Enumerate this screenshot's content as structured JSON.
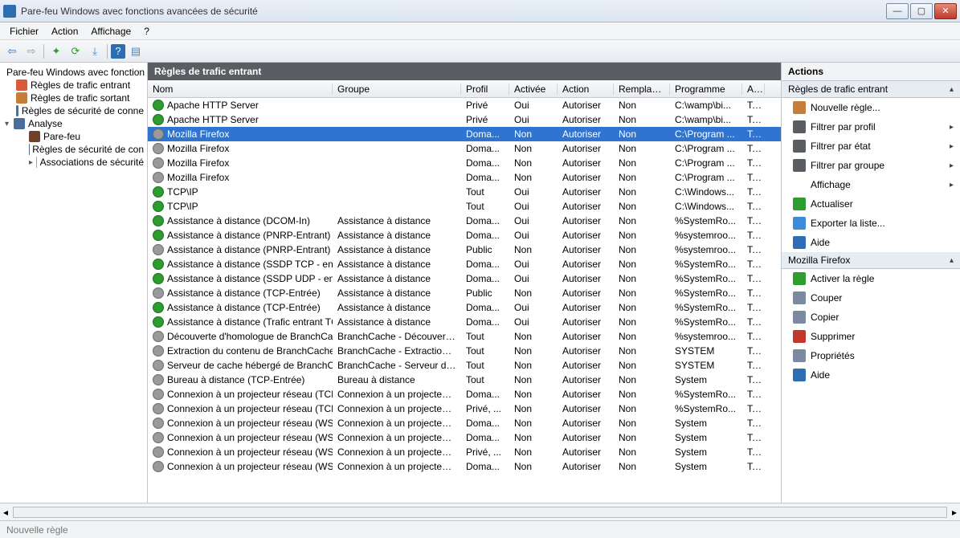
{
  "titlebar": {
    "title": "Pare-feu Windows avec fonctions avancées de sécurité"
  },
  "menubar": [
    "Fichier",
    "Action",
    "Affichage",
    "?"
  ],
  "tree": {
    "root": "Pare-feu Windows avec fonction",
    "items": [
      "Règles de trafic entrant",
      "Règles de trafic sortant",
      "Règles de sécurité de conne"
    ],
    "analyse": "Analyse",
    "analyse_children": [
      "Pare-feu",
      "Règles de sécurité de con",
      "Associations de sécurité"
    ]
  },
  "grid": {
    "title": "Règles de trafic entrant",
    "headers": {
      "nom": "Nom",
      "grp": "Groupe",
      "prof": "Profil",
      "act": "Activée",
      "action": "Action",
      "rep": "Remplacer",
      "prog": "Programme",
      "adr": "Adr"
    },
    "rows": [
      {
        "on": true,
        "nom": "Apache HTTP Server",
        "grp": "",
        "prof": "Privé",
        "act": "Oui",
        "action": "Autoriser",
        "rep": "Non",
        "prog": "C:\\wamp\\bi...",
        "adr": "Tou"
      },
      {
        "on": true,
        "nom": "Apache HTTP Server",
        "grp": "",
        "prof": "Privé",
        "act": "Oui",
        "action": "Autoriser",
        "rep": "Non",
        "prog": "C:\\wamp\\bi...",
        "adr": "Tou"
      },
      {
        "on": false,
        "sel": true,
        "nom": "Mozilla Firefox",
        "grp": "",
        "prof": "Doma...",
        "act": "Non",
        "action": "Autoriser",
        "rep": "Non",
        "prog": "C:\\Program ...",
        "adr": "Tou"
      },
      {
        "on": false,
        "nom": "Mozilla Firefox",
        "grp": "",
        "prof": "Doma...",
        "act": "Non",
        "action": "Autoriser",
        "rep": "Non",
        "prog": "C:\\Program ...",
        "adr": "Tou"
      },
      {
        "on": false,
        "nom": "Mozilla Firefox",
        "grp": "",
        "prof": "Doma...",
        "act": "Non",
        "action": "Autoriser",
        "rep": "Non",
        "prog": "C:\\Program ...",
        "adr": "Tou"
      },
      {
        "on": false,
        "nom": "Mozilla Firefox",
        "grp": "",
        "prof": "Doma...",
        "act": "Non",
        "action": "Autoriser",
        "rep": "Non",
        "prog": "C:\\Program ...",
        "adr": "Tou"
      },
      {
        "on": true,
        "nom": "TCP\\IP",
        "grp": "",
        "prof": "Tout",
        "act": "Oui",
        "action": "Autoriser",
        "rep": "Non",
        "prog": "C:\\Windows...",
        "adr": "Tou"
      },
      {
        "on": true,
        "nom": "TCP\\IP",
        "grp": "",
        "prof": "Tout",
        "act": "Oui",
        "action": "Autoriser",
        "rep": "Non",
        "prog": "C:\\Windows...",
        "adr": "Tou"
      },
      {
        "on": true,
        "nom": "Assistance à distance (DCOM-In)",
        "grp": "Assistance à distance",
        "prof": "Doma...",
        "act": "Oui",
        "action": "Autoriser",
        "rep": "Non",
        "prog": "%SystemRo...",
        "adr": "Tou"
      },
      {
        "on": true,
        "nom": "Assistance à distance (PNRP-Entrant)",
        "grp": "Assistance à distance",
        "prof": "Doma...",
        "act": "Oui",
        "action": "Autoriser",
        "rep": "Non",
        "prog": "%systemroo...",
        "adr": "Tou"
      },
      {
        "on": false,
        "nom": "Assistance à distance (PNRP-Entrant)",
        "grp": "Assistance à distance",
        "prof": "Public",
        "act": "Non",
        "action": "Autoriser",
        "rep": "Non",
        "prog": "%systemroo...",
        "adr": "Tou"
      },
      {
        "on": true,
        "nom": "Assistance à distance (SSDP TCP - en ent...",
        "grp": "Assistance à distance",
        "prof": "Doma...",
        "act": "Oui",
        "action": "Autoriser",
        "rep": "Non",
        "prog": "%SystemRo...",
        "adr": "Tou"
      },
      {
        "on": true,
        "nom": "Assistance à distance (SSDP UDP - en ent...",
        "grp": "Assistance à distance",
        "prof": "Doma...",
        "act": "Oui",
        "action": "Autoriser",
        "rep": "Non",
        "prog": "%SystemRo...",
        "adr": "Tou"
      },
      {
        "on": false,
        "nom": "Assistance à distance (TCP-Entrée)",
        "grp": "Assistance à distance",
        "prof": "Public",
        "act": "Non",
        "action": "Autoriser",
        "rep": "Non",
        "prog": "%SystemRo...",
        "adr": "Tou"
      },
      {
        "on": true,
        "nom": "Assistance à distance (TCP-Entrée)",
        "grp": "Assistance à distance",
        "prof": "Doma...",
        "act": "Oui",
        "action": "Autoriser",
        "rep": "Non",
        "prog": "%SystemRo...",
        "adr": "Tou"
      },
      {
        "on": true,
        "nom": "Assistance à distance (Trafic entrant TCP ...",
        "grp": "Assistance à distance",
        "prof": "Doma...",
        "act": "Oui",
        "action": "Autoriser",
        "rep": "Non",
        "prog": "%SystemRo...",
        "adr": "Tou"
      },
      {
        "on": false,
        "nom": "Découverte d'homologue de BranchCac...",
        "grp": "BranchCache - Découverte ...",
        "prof": "Tout",
        "act": "Non",
        "action": "Autoriser",
        "rep": "Non",
        "prog": "%systemroo...",
        "adr": "Tou"
      },
      {
        "on": false,
        "nom": "Extraction du contenu de BranchCache (...",
        "grp": "BranchCache - Extraction d...",
        "prof": "Tout",
        "act": "Non",
        "action": "Autoriser",
        "rep": "Non",
        "prog": "SYSTEM",
        "adr": "Tou"
      },
      {
        "on": false,
        "nom": "Serveur de cache hébergé de BranchCac...",
        "grp": "BranchCache - Serveur de c...",
        "prof": "Tout",
        "act": "Non",
        "action": "Autoriser",
        "rep": "Non",
        "prog": "SYSTEM",
        "adr": "Tou"
      },
      {
        "on": false,
        "nom": "Bureau à distance (TCP-Entrée)",
        "grp": "Bureau à distance",
        "prof": "Tout",
        "act": "Non",
        "action": "Autoriser",
        "rep": "Non",
        "prog": "System",
        "adr": "Tou"
      },
      {
        "on": false,
        "nom": "Connexion à un projecteur réseau (TCP-E...",
        "grp": "Connexion à un projecteur r...",
        "prof": "Doma...",
        "act": "Non",
        "action": "Autoriser",
        "rep": "Non",
        "prog": "%SystemRo...",
        "adr": "Tou"
      },
      {
        "on": false,
        "nom": "Connexion à un projecteur réseau (TCP-E...",
        "grp": "Connexion à un projecteur r...",
        "prof": "Privé, ...",
        "act": "Non",
        "action": "Autoriser",
        "rep": "Non",
        "prog": "%SystemRo...",
        "adr": "Tou"
      },
      {
        "on": false,
        "nom": "Connexion à un projecteur réseau (WSD ...",
        "grp": "Connexion à un projecteur r...",
        "prof": "Doma...",
        "act": "Non",
        "action": "Autoriser",
        "rep": "Non",
        "prog": "System",
        "adr": "Tou"
      },
      {
        "on": false,
        "nom": "Connexion à un projecteur réseau (WSD ...",
        "grp": "Connexion à un projecteur r...",
        "prof": "Doma...",
        "act": "Non",
        "action": "Autoriser",
        "rep": "Non",
        "prog": "System",
        "adr": "Tou"
      },
      {
        "on": false,
        "nom": "Connexion à un projecteur réseau (WSD ...",
        "grp": "Connexion à un projecteur r...",
        "prof": "Privé, ...",
        "act": "Non",
        "action": "Autoriser",
        "rep": "Non",
        "prog": "System",
        "adr": "Tou"
      },
      {
        "on": false,
        "nom": "Connexion à un projecteur réseau (WSD ...",
        "grp": "Connexion à un projecteur r...",
        "prof": "Doma...",
        "act": "Non",
        "action": "Autoriser",
        "rep": "Non",
        "prog": "System",
        "adr": "Tou"
      }
    ]
  },
  "actions": {
    "title": "Actions",
    "group1": {
      "title": "Règles de trafic entrant",
      "items": [
        {
          "ico": "#c77c3a",
          "label": "Nouvelle règle..."
        },
        {
          "ico": "#5a5e63",
          "label": "Filtrer par profil",
          "sub": true
        },
        {
          "ico": "#5a5e63",
          "label": "Filtrer par état",
          "sub": true
        },
        {
          "ico": "#5a5e63",
          "label": "Filtrer par groupe",
          "sub": true
        },
        {
          "ico": "",
          "label": "Affichage",
          "sub": true
        },
        {
          "ico": "#2e9c2e",
          "label": "Actualiser"
        },
        {
          "ico": "#3b8bd9",
          "label": "Exporter la liste..."
        },
        {
          "ico": "#2e6db1",
          "label": "Aide"
        }
      ]
    },
    "group2": {
      "title": "Mozilla Firefox",
      "items": [
        {
          "ico": "#2e9c2e",
          "label": "Activer la règle"
        },
        {
          "ico": "#7a8aa0",
          "label": "Couper"
        },
        {
          "ico": "#7a8aa0",
          "label": "Copier"
        },
        {
          "ico": "#c0392b",
          "label": "Supprimer"
        },
        {
          "ico": "#7a8aa0",
          "label": "Propriétés"
        },
        {
          "ico": "#2e6db1",
          "label": "Aide"
        }
      ]
    }
  },
  "status": "Nouvelle règle"
}
